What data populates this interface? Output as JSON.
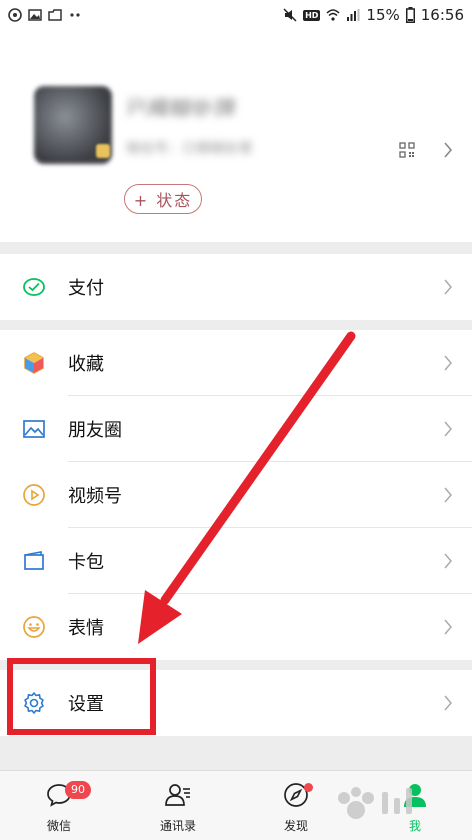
{
  "status_bar": {
    "battery_percent": "15%",
    "time": "16:56",
    "hd_label": "HD"
  },
  "profile": {
    "nickname": "已模糊处理",
    "wechat_id": "微信号：已模糊处理",
    "status_button_label": "+ 状态"
  },
  "menu": {
    "pay": "支付",
    "favorites": "收藏",
    "moments": "朋友圈",
    "channels": "视频号",
    "cards": "卡包",
    "stickers": "表情",
    "settings": "设置"
  },
  "tabbar": {
    "chats_label": "微信",
    "chats_badge": "90",
    "contacts_label": "通讯录",
    "discover_label": "发现",
    "me_label": "我"
  },
  "colors": {
    "accent_green": "#07c160",
    "annotation_red": "#e5212b",
    "badge_red": "#f0464e"
  }
}
